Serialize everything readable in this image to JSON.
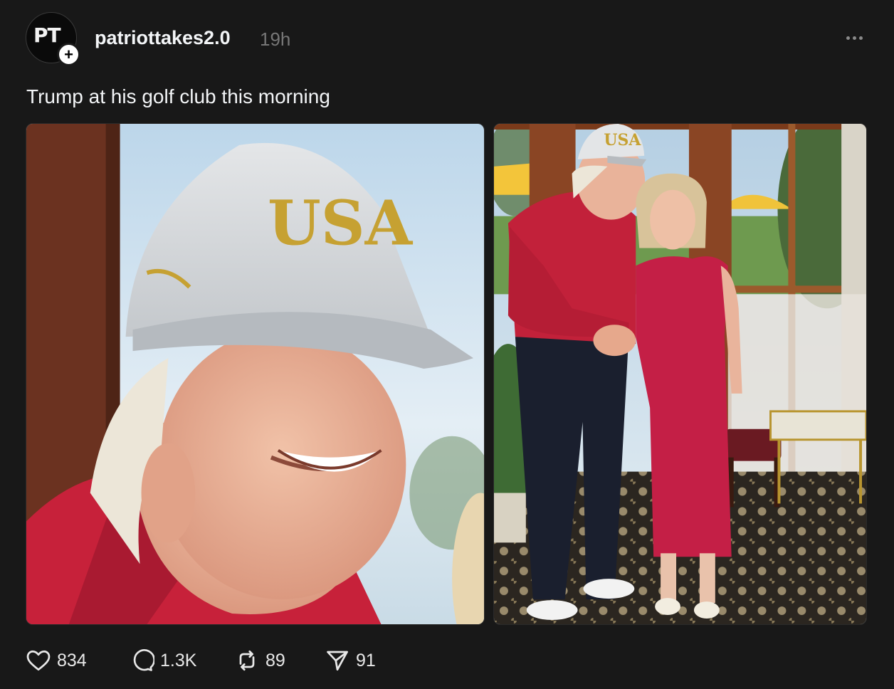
{
  "post": {
    "author": {
      "avatar_text": "PT",
      "username": "patriottakes2.0",
      "time_ago": "19h"
    },
    "caption": "Trump at his golf club this morning",
    "images": [
      {
        "alt": "Close-up of man in white USA cap and red shirt smiling"
      },
      {
        "alt": "Man in red polo and white USA cap standing with woman in red dress indoors"
      }
    ],
    "cap_text": "USA",
    "actions": {
      "likes": "834",
      "replies": "1.3K",
      "reposts": "89",
      "shares": "91"
    },
    "icons": {
      "like": "heart-icon",
      "reply": "speech-bubble-icon",
      "repost": "repost-arrows-icon",
      "share": "send-plane-icon",
      "more": "ellipsis-icon",
      "follow": "plus-icon"
    }
  }
}
